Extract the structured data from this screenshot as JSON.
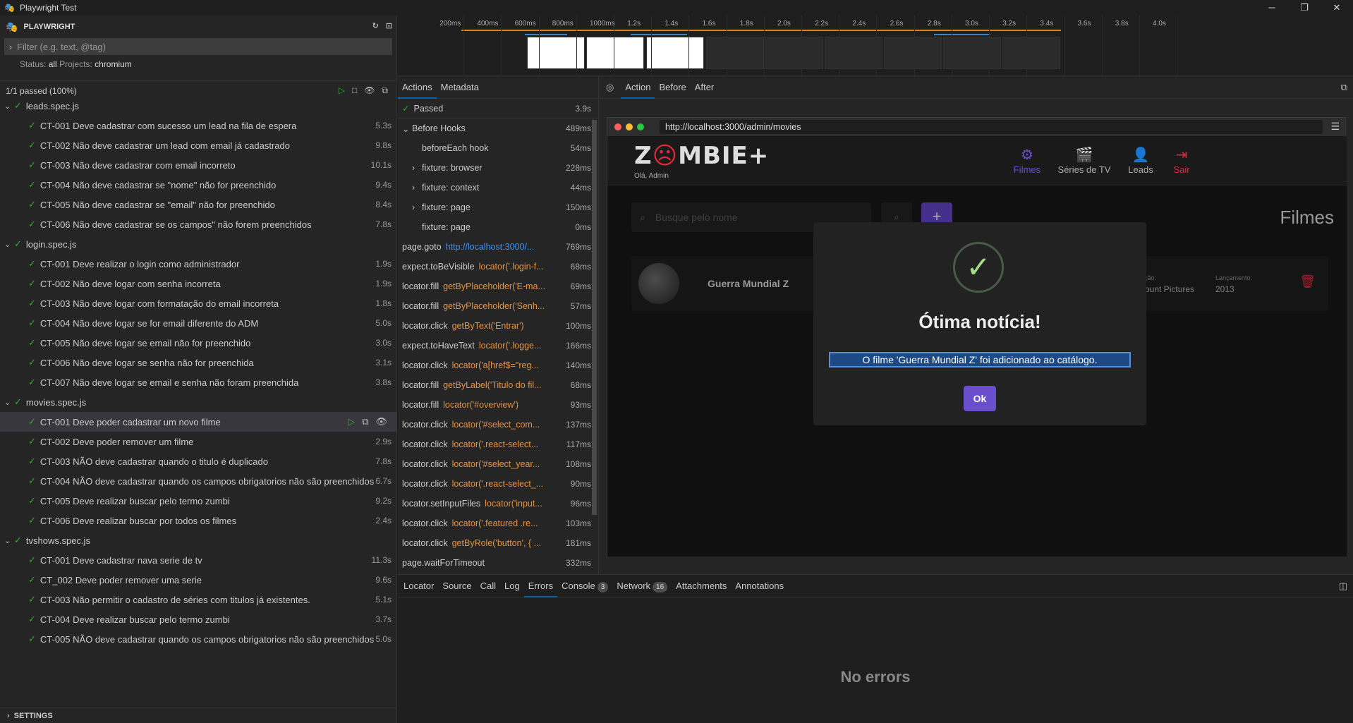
{
  "window": {
    "title": "Playwright Test"
  },
  "sidebar": {
    "header": "PLAYWRIGHT",
    "filter_placeholder": "Filter (e.g. text, @tag)",
    "status_label": "Status:",
    "status_value": "all",
    "projects_label": "Projects:",
    "projects_value": "chromium",
    "summary": "1/1 passed (100%)",
    "settings": "SETTINGS"
  },
  "tree": [
    {
      "type": "file",
      "label": "leads.spec.js"
    },
    {
      "type": "test",
      "label": "CT-001 Deve cadastrar com sucesso um lead na fila de espera",
      "dur": "5.3s"
    },
    {
      "type": "test",
      "label": "CT-002 Não deve cadastrar um lead com email já cadastrado",
      "dur": "9.8s"
    },
    {
      "type": "test",
      "label": "CT-003 Não deve cadastrar com email incorreto",
      "dur": "10.1s"
    },
    {
      "type": "test",
      "label": "CT-004 Não deve cadastrar se \"nome\" não for preenchido",
      "dur": "9.4s"
    },
    {
      "type": "test",
      "label": "CT-005 Não deve cadastrar se \"email\" não for preenchido",
      "dur": "8.4s"
    },
    {
      "type": "test",
      "label": "CT-006 Não deve cadastrar se os campos\" não forem preenchidos",
      "dur": "7.8s"
    },
    {
      "type": "file",
      "label": "login.spec.js"
    },
    {
      "type": "test",
      "label": "CT-001 Deve realizar o login como administrador",
      "dur": "1.9s"
    },
    {
      "type": "test",
      "label": "CT-002 Não deve logar com senha incorreta",
      "dur": "1.9s"
    },
    {
      "type": "test",
      "label": "CT-003 Não deve logar com formatação do email incorreta",
      "dur": "1.8s"
    },
    {
      "type": "test",
      "label": "CT-004 Não deve logar se for email diferente do ADM",
      "dur": "5.0s"
    },
    {
      "type": "test",
      "label": "CT-005 Não deve logar se email não for preenchido",
      "dur": "3.0s"
    },
    {
      "type": "test",
      "label": "CT-006 Não deve logar se senha não for preenchida",
      "dur": "3.1s"
    },
    {
      "type": "test",
      "label": "CT-007 Não deve logar se email e senha não foram preenchida",
      "dur": "3.8s"
    },
    {
      "type": "file",
      "label": "movies.spec.js"
    },
    {
      "type": "test",
      "label": "CT-001 Deve poder cadastrar um novo filme",
      "dur": "",
      "selected": true
    },
    {
      "type": "test",
      "label": "CT-002 Deve poder remover um filme",
      "dur": "2.9s"
    },
    {
      "type": "test",
      "label": "CT-003 NÃO deve cadastrar quando o titulo é duplicado",
      "dur": "7.8s"
    },
    {
      "type": "test",
      "label": "CT-004 NÃO deve cadastrar quando os campos obrigatorios não são preenchidos",
      "dur": "6.7s"
    },
    {
      "type": "test",
      "label": "CT-005 Deve realizar buscar pelo termo zumbi",
      "dur": "9.2s"
    },
    {
      "type": "test",
      "label": "CT-006 Deve realizar buscar por todos os filmes",
      "dur": "2.4s"
    },
    {
      "type": "file",
      "label": "tvshows.spec.js"
    },
    {
      "type": "test",
      "label": "CT-001 Deve cadastrar nava serie de tv",
      "dur": "11.3s"
    },
    {
      "type": "test",
      "label": "CT_002 Deve poder remover uma serie",
      "dur": "9.6s"
    },
    {
      "type": "test",
      "label": "CT-003 Não permitir o cadastro de séries com titulos já existentes.",
      "dur": "5.1s"
    },
    {
      "type": "test",
      "label": "CT-004 Deve realizar buscar pelo termo zumbi",
      "dur": "3.7s"
    },
    {
      "type": "test",
      "label": "CT-005 NÃO deve cadastrar quando os campos obrigatorios não são preenchidos",
      "dur": "5.0s"
    }
  ],
  "timeline": {
    "ticks": [
      "200ms",
      "400ms",
      "600ms",
      "800ms",
      "1000ms",
      "1.2s",
      "1.4s",
      "1.6s",
      "1.8s",
      "2.0s",
      "2.2s",
      "2.4s",
      "2.6s",
      "2.8s",
      "3.0s",
      "3.2s",
      "3.4s",
      "3.6s",
      "3.8s",
      "4.0s"
    ]
  },
  "actions_tabs": [
    "Actions",
    "Metadata"
  ],
  "actions": [
    {
      "kind": "passed",
      "label": "Passed",
      "dur": "3.9s"
    },
    {
      "kind": "group",
      "label": "Before Hooks",
      "dur": "489ms"
    },
    {
      "kind": "child",
      "label": "beforeEach hook",
      "dur": "54ms"
    },
    {
      "kind": "childexp",
      "label": "fixture: browser",
      "dur": "228ms"
    },
    {
      "kind": "childexp",
      "label": "fixture: context",
      "dur": "44ms"
    },
    {
      "kind": "childexp",
      "label": "fixture: page",
      "dur": "150ms"
    },
    {
      "kind": "child",
      "label": "fixture: page",
      "dur": "0ms"
    },
    {
      "kind": "link",
      "label": "page.goto",
      "arg": "http://localhost:3000/...",
      "dur": "769ms"
    },
    {
      "kind": "sel",
      "label": "expect.toBeVisible",
      "arg": "locator('.login-f...",
      "dur": "68ms"
    },
    {
      "kind": "sel",
      "label": "locator.fill",
      "arg": "getByPlaceholder('E-ma...",
      "dur": "69ms"
    },
    {
      "kind": "sel",
      "label": "locator.fill",
      "arg": "getByPlaceholder('Senh...",
      "dur": "57ms"
    },
    {
      "kind": "sel",
      "label": "locator.click",
      "arg": "getByText('Entrar')",
      "dur": "100ms"
    },
    {
      "kind": "sel",
      "label": "expect.toHaveText",
      "arg": "locator('.logge...",
      "dur": "166ms"
    },
    {
      "kind": "sel",
      "label": "locator.click",
      "arg": "locator('a[href$=\"reg...",
      "dur": "140ms"
    },
    {
      "kind": "sel",
      "label": "locator.fill",
      "arg": "getByLabel('Titulo do fil...",
      "dur": "68ms"
    },
    {
      "kind": "sel",
      "label": "locator.fill",
      "arg": "locator('#overview')",
      "dur": "93ms"
    },
    {
      "kind": "sel",
      "label": "locator.click",
      "arg": "locator('#select_com...",
      "dur": "137ms"
    },
    {
      "kind": "sel",
      "label": "locator.click",
      "arg": "locator('.react-select...",
      "dur": "117ms"
    },
    {
      "kind": "sel",
      "label": "locator.click",
      "arg": "locator('#select_year...",
      "dur": "108ms"
    },
    {
      "kind": "sel",
      "label": "locator.click",
      "arg": "locator('.react-select_...",
      "dur": "90ms"
    },
    {
      "kind": "sel",
      "label": "locator.setInputFiles",
      "arg": "locator('input...",
      "dur": "96ms"
    },
    {
      "kind": "sel",
      "label": "locator.click",
      "arg": "locator('.featured .re...",
      "dur": "103ms"
    },
    {
      "kind": "sel",
      "label": "locator.click",
      "arg": "getByRole('button', { ...",
      "dur": "181ms"
    },
    {
      "kind": "plain",
      "label": "page.waitForTimeout",
      "dur": "332ms"
    }
  ],
  "snapshot": {
    "tabs": [
      "Action",
      "Before",
      "After"
    ],
    "url": "http://localhost:3000/admin/movies",
    "app": {
      "brand_pre": "Z",
      "brand_o": "☹",
      "brand_post": "MBIE+",
      "greeting": "Olá, Admin",
      "nav": [
        {
          "label": "Filmes",
          "icon": "film-reel-icon",
          "glyph": "⚙"
        },
        {
          "label": "Séries de TV",
          "icon": "clapper-icon",
          "glyph": "🎬"
        },
        {
          "label": "Leads",
          "icon": "user-icon",
          "glyph": "👤"
        },
        {
          "label": "Sair",
          "icon": "logout-icon",
          "glyph": "⇥"
        }
      ],
      "search_placeholder": "Busque pelo nome",
      "add_label": "+",
      "page_title": "Filmes",
      "movie": {
        "title": "Guerra Mundial Z",
        "company_label": "ição:",
        "company_value": "mount Pictures",
        "release_label": "Lançamento:",
        "release_value": "2013"
      },
      "modal": {
        "title": "Ótima notícia!",
        "message": "O filme 'Guerra Mundial Z' foi adicionado ao catálogo.",
        "ok": "Ok"
      }
    }
  },
  "bottom_tabs": [
    {
      "label": "Locator"
    },
    {
      "label": "Source"
    },
    {
      "label": "Call"
    },
    {
      "label": "Log"
    },
    {
      "label": "Errors",
      "active": true
    },
    {
      "label": "Console",
      "badge": "3"
    },
    {
      "label": "Network",
      "badge": "16"
    },
    {
      "label": "Attachments"
    },
    {
      "label": "Annotations"
    }
  ],
  "bottom_empty": "No errors",
  "colors": {
    "pass": "#2ead33",
    "accent": "#6a4ecb",
    "danger": "#e0293d",
    "selector": "#e8933a",
    "link": "#3794ff"
  }
}
